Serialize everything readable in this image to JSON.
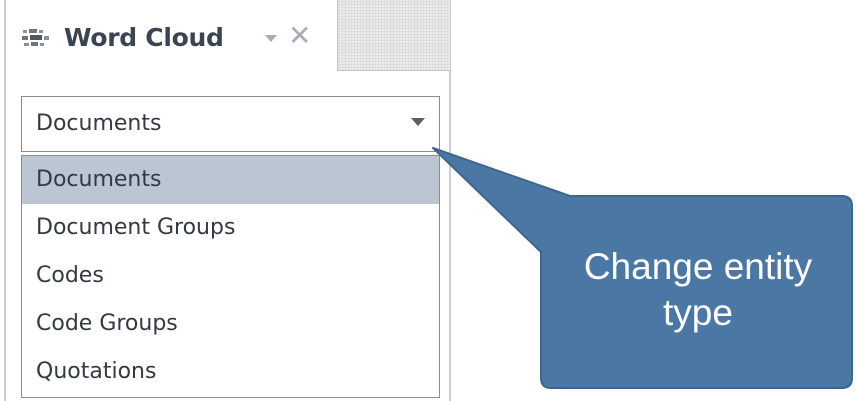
{
  "panel": {
    "tab_title": "Word Cloud",
    "tab_icon": "word-cloud-icon",
    "tab_dropdown_icon": "chevron-down-icon",
    "tab_close_glyph": "✕"
  },
  "entity_select": {
    "value": "Documents",
    "options": [
      {
        "label": "Documents",
        "selected": true
      },
      {
        "label": "Document Groups",
        "selected": false
      },
      {
        "label": "Codes",
        "selected": false
      },
      {
        "label": "Code Groups",
        "selected": false
      },
      {
        "label": "Quotations",
        "selected": false
      }
    ]
  },
  "callout": {
    "line1": "Change entity",
    "line2": "type"
  },
  "colors": {
    "callout_fill": "#4a77a3",
    "callout_stroke": "#3b6690",
    "selected_option_bg": "#bcc6d2",
    "title_text": "#3a4453"
  }
}
